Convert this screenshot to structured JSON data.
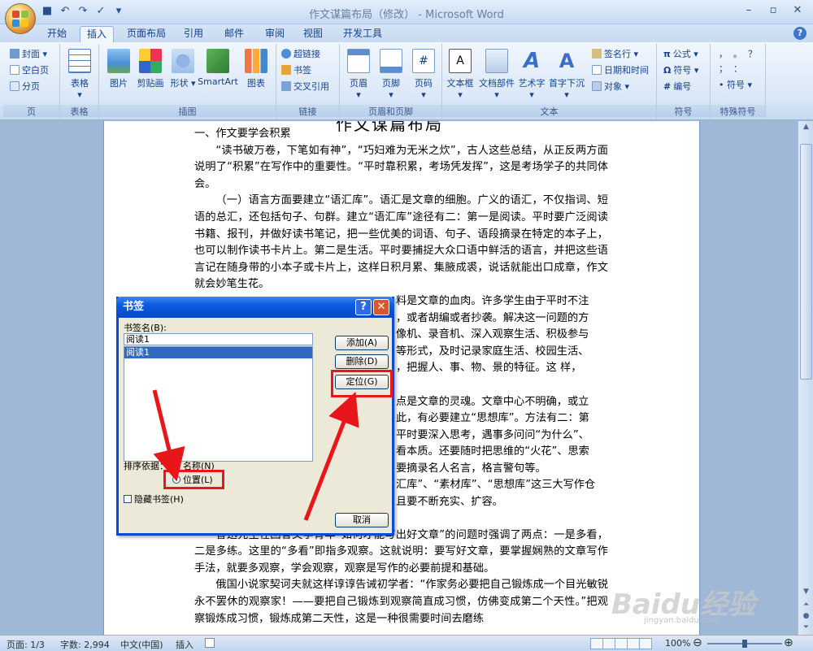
{
  "window": {
    "title": "作文谋篇布局（修改） - Microsoft Word",
    "minimize": "–",
    "restore": "▫",
    "close": "✕"
  },
  "tabs": [
    "开始",
    "插入",
    "页面布局",
    "引用",
    "邮件",
    "审阅",
    "视图",
    "开发工具"
  ],
  "ribbon": {
    "groups": {
      "pages": {
        "label": "页",
        "items": [
          "封面",
          "空白页",
          "分页"
        ]
      },
      "tables": {
        "label": "表格",
        "items": [
          "表格"
        ]
      },
      "illustrations": {
        "label": "插图",
        "items": [
          "图片",
          "剪贴画",
          "形状",
          "SmartArt",
          "图表"
        ]
      },
      "links": {
        "label": "链接",
        "items": [
          "超链接",
          "书签",
          "交叉引用"
        ]
      },
      "header_footer": {
        "label": "页眉和页脚",
        "items": [
          "页眉",
          "页脚",
          "页码"
        ]
      },
      "text": {
        "label": "文本",
        "items": [
          "文本框",
          "文档部件",
          "艺术字",
          "首字下沉",
          "签名行",
          "日期和时间",
          "对象"
        ]
      },
      "symbols": {
        "label": "符号",
        "items": [
          "公式",
          "符号",
          "编号"
        ]
      },
      "special": {
        "label": "特殊符号",
        "items": [
          "，",
          "。",
          "；",
          "：",
          "？",
          "符号"
        ]
      }
    }
  },
  "document": {
    "cut_title": "作文谋篇布局",
    "heading1": "一、作文要学会积累",
    "paragraphs": [
      "“读书破万卷，下笔如有神”，“巧妇难为无米之炊”，古人这些总结，从正反两方面说明了“积累”在写作中的重要性。“平时靠积累，考场凭发挥”，这是考场学子的共同体会。",
      "（一）语言方面要建立“语汇库”。语汇是文章的细胞。广义的语汇，不仅指词、短语的总汇，还包括句子、句群。建立“语汇库”途径有二：第一是阅读。平时要广泛阅读书籍、报刊，并做好读书笔记，把一些优美的词语、句子、语段摘录在特定的本子上，也可以制作读书卡片上。第二是生活。平时要捕捉大众口语中鲜活的语言，并把这些语言记在随身带的小本子或卡片上，这样日积月累、集腋成裘，说话就能出口成章，作文就会妙笔生花。"
    ],
    "partial_lines": [
      "料是文章的血肉。许多学生由于平时不注",
      "，或者胡编或者抄袭。解决这一问题的方",
      "像机、录音机、深入观察生活、积极参与",
      "等形式，及时记录家庭生活、校园生活、",
      "，把握人、事、物、景的特征。这 样，",
      "",
      "点是文章的灵魂。文章中心不明确，或立",
      "此，有必要建立“思想库”。方法有二：第",
      "平时要深入思考，遇事多问问“为什么”、",
      "看本质。还要随时把思维的“火花”、思索",
      "要摘录名人名言，格言警句等。",
      "汇库”、“素材库”、“思想库”这三大写作仓",
      "且要不断充实、扩容。"
    ],
    "paragraphs2": [
      "鲁迅先生在回答文学青年“如何才能写出好文章”的问题时强调了两点：一是多看，二是多练。这里的“多看”即指多观察。这就说明：要写好文章，要掌握娴熟的文章写作手法，就要多观察，学会观察，观察是写作的必要前提和基础。",
      "俄国小说家契诃夫就这样谆谆告诫初学者：“作家务必要把自己锻炼成一个目光敏锐永不罢休的观察家！——要把自己锻炼到观察简直成习惯，仿佛变成第二个天性。”把观察锻炼成习惯，锻炼成第二天性，这是一种很需要时间去磨练"
    ]
  },
  "dialog": {
    "title": "书签",
    "help": "?",
    "close": "✕",
    "name_label": "书签名(B):",
    "name_value": "阅读1",
    "list_items": [
      "阅读1"
    ],
    "buttons": {
      "add": "添加(A)",
      "delete": "删除(D)",
      "goto": "定位(G)",
      "cancel": "取消"
    },
    "sort_label": "排序依据：",
    "sort_name": "名称(N)",
    "sort_position": "位置(L)",
    "hidden_label": "隐藏书签(H)"
  },
  "status": {
    "page": "页面: 1/3",
    "words": "字数: 2,994",
    "lang": "中文(中国)",
    "mode": "插入",
    "zoom": "100%"
  },
  "watermark": {
    "brand": "Baidu经验",
    "url": "jingyan.baidu.com"
  },
  "colors": {
    "accent": "#e8151b",
    "dialog_title": "#0a5be0",
    "ribbon": "#dbe8f7"
  }
}
